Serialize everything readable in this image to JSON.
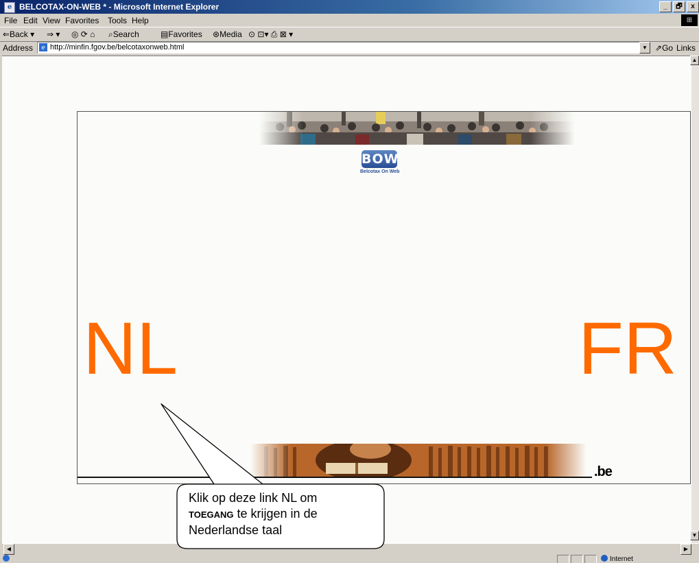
{
  "window": {
    "title": "BELCOTAX-ON-WEB * - Microsoft Internet Explorer",
    "controls": [
      "_",
      "🗗",
      "x"
    ]
  },
  "menu": [
    "File",
    "Edit",
    "View",
    "Favorites",
    "Tools",
    "Help"
  ],
  "toolbar": {
    "back": "⇐Back ▾",
    "forward": "⇒ ▾",
    "stop_refresh_home": "◎ ⟳ ⌂",
    "search": "Search",
    "favorites": "Favorites",
    "media": "Media",
    "tools": "⊙  ⊡▾ ⎙ ⊠ ▾"
  },
  "address": {
    "label": "Address",
    "url": "http://minfin.fgov.be/belcotaxonweb.html",
    "go": "Go",
    "links": "Links"
  },
  "page": {
    "logo_text": "BOW",
    "logo_subtitle": "Belcotax On Web",
    "nl_link": "NL",
    "fr_link": "FR",
    "be_logo": ".be",
    "link_color": "#ff6a00"
  },
  "callout": {
    "line1": "Klik op deze link NL om",
    "bold": "TOEGANG",
    "line2_rest": "te krijgen in de",
    "line3": "Nederlandse taal"
  },
  "status": {
    "zone": "Internet"
  },
  "icons": {
    "title": "ie-page-icon",
    "address": "ie-page-icon",
    "status": "ie-globe-icon"
  }
}
